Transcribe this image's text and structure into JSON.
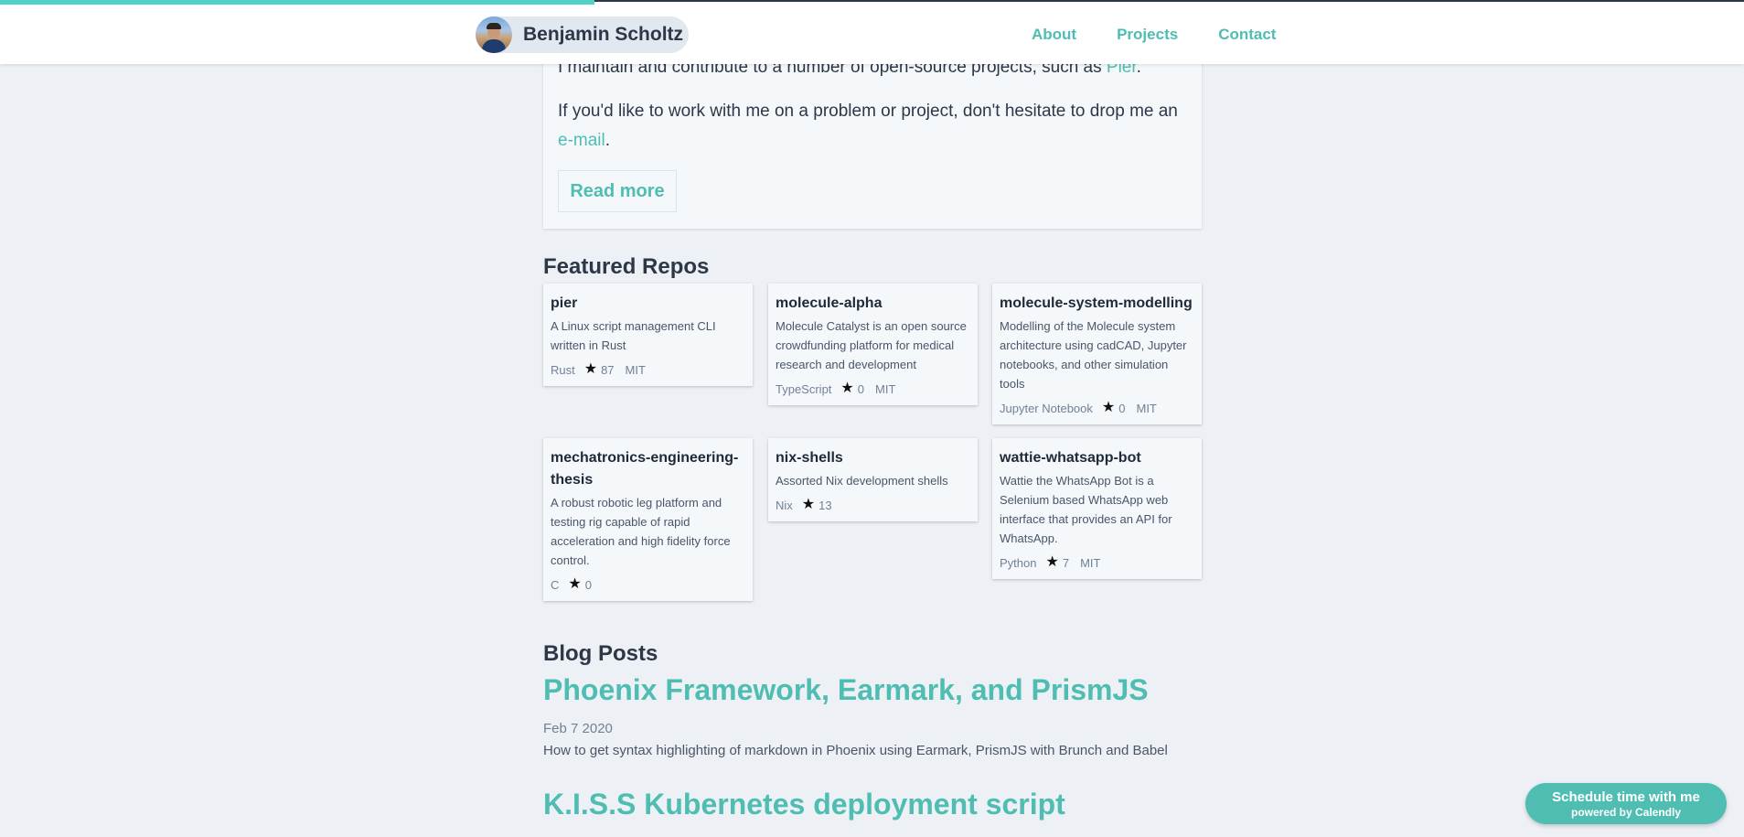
{
  "header": {
    "brand_name": "Benjamin Scholtz",
    "nav": [
      "About",
      "Projects",
      "Contact"
    ],
    "progress_fraction": 0.34
  },
  "about": {
    "line1_prefix": "I maintain and contribute to a number of open-source projects, such as ",
    "line1_link": "Pier",
    "line1_suffix": ".",
    "line2_text": "If you'd like to work with me on a problem or project, don't hesitate to drop me an",
    "line2_link": "e-mail",
    "line2_suffix": ".",
    "read_more": "Read more"
  },
  "featured": {
    "title": "Featured Repos",
    "repos": [
      {
        "name": "pier",
        "description": "A Linux script management CLI written in Rust",
        "language": "Rust",
        "stars": "87",
        "license": "MIT"
      },
      {
        "name": "molecule-alpha",
        "description": "Molecule Catalyst is an open source crowdfunding platform for medical research and development",
        "language": "TypeScript",
        "stars": "0",
        "license": "MIT"
      },
      {
        "name": "molecule-system-modelling",
        "description": "Modelling of the Molecule system architecture using cadCAD, Jupyter notebooks, and other simulation tools",
        "language": "Jupyter Notebook",
        "stars": "0",
        "license": "MIT"
      },
      {
        "name": "mechatronics-engineering-thesis",
        "description": "A robust robotic leg platform and testing rig capable of rapid acceleration and high fidelity force control.",
        "language": "C",
        "stars": "0",
        "license": ""
      },
      {
        "name": "nix-shells",
        "description": "Assorted Nix development shells",
        "language": "Nix",
        "stars": "13",
        "license": ""
      },
      {
        "name": "wattie-whatsapp-bot",
        "description": "Wattie the WhatsApp Bot is a Selenium based WhatsApp web interface that provides an API for WhatsApp.",
        "language": "Python",
        "stars": "7",
        "license": "MIT"
      }
    ]
  },
  "blog": {
    "title": "Blog Posts",
    "posts": [
      {
        "title": "Phoenix Framework, Earmark, and PrismJS",
        "date": "Feb 7 2020",
        "description": "How to get syntax highlighting of markdown in Phoenix using Earmark, PrismJS with Brunch and Babel"
      },
      {
        "title": "K.I.S.S Kubernetes deployment script"
      }
    ]
  },
  "calendly": {
    "main": "Schedule time with me",
    "sub": "powered by Calendly"
  },
  "colors": {
    "accent": "#4fbdb1",
    "text": "#2d3748",
    "background": "#edf1f5"
  },
  "icons": [
    "star-icon"
  ]
}
